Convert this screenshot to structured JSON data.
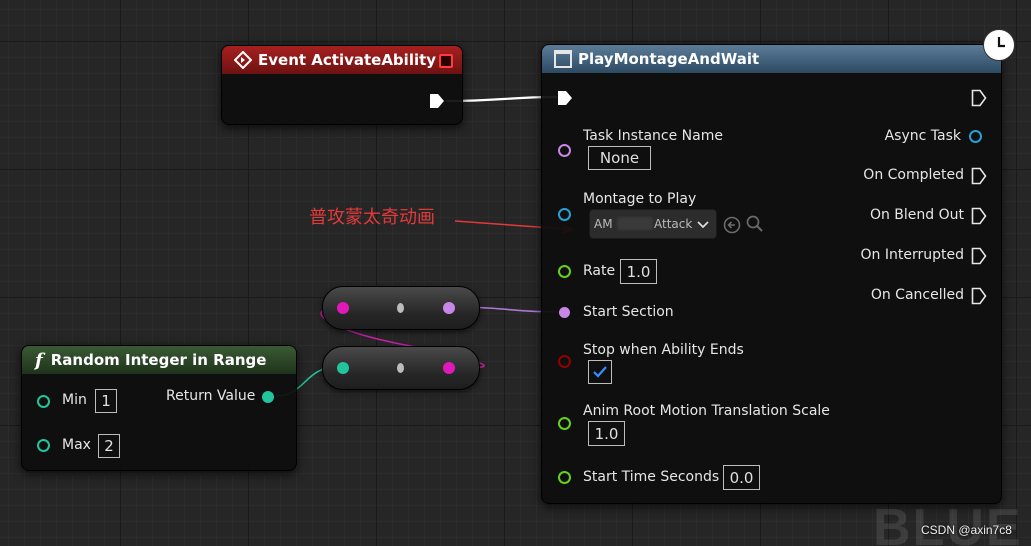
{
  "event_node": {
    "title": "Event ActivateAbility"
  },
  "random_node": {
    "title": "Random Integer in Range",
    "min_label": "Min",
    "min_value": "1",
    "max_label": "Max",
    "max_value": "2",
    "return_label": "Return Value"
  },
  "montage_node": {
    "title": "PlayMontageAndWait",
    "task_instance_label": "Task Instance Name",
    "task_instance_value": "None",
    "montage_label": "Montage to Play",
    "montage_value_prefix": "AM",
    "montage_value_suffix": "Attack",
    "rate_label": "Rate",
    "rate_value": "1.0",
    "start_section_label": "Start Section",
    "stop_label": "Stop when Ability Ends",
    "stop_checked": true,
    "anim_root_label": "Anim Root Motion Translation Scale",
    "anim_root_value": "1.0",
    "start_time_label": "Start Time Seconds",
    "start_time_value": "0.0",
    "outputs": {
      "async_task": "Async Task",
      "on_completed": "On Completed",
      "on_blend_out": "On Blend Out",
      "on_interrupted": "On Interrupted",
      "on_cancelled": "On Cancelled"
    }
  },
  "annotation": {
    "text": "普攻蒙太奇动画"
  },
  "watermark": {
    "text": "CSDN @axin7c8",
    "bg_text": "BLUE"
  },
  "colors": {
    "event_header": "#8f1a1a",
    "function_header": "#2a4226",
    "latent_header": "#3f5f7b",
    "name_pin": "#c886e6",
    "object_pin": "#27a0d6",
    "float_pin": "#64d11e",
    "int_pin": "#23c49c",
    "bool_pin": "#900000",
    "annotation_red": "#e23a3a"
  }
}
